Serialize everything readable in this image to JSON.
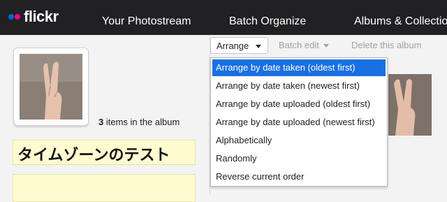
{
  "brand": {
    "name": "flickr",
    "dot_left_color": "#0063dc",
    "dot_right_color": "#ff0084"
  },
  "nav": {
    "items": [
      {
        "label": "Your Photostream"
      },
      {
        "label": "Batch Organize"
      },
      {
        "label": "Albums & Collectio"
      }
    ]
  },
  "album": {
    "count": "3",
    "count_suffix": " items in the album",
    "title": "タイムゾーンのテスト",
    "description": ""
  },
  "toolbar": {
    "arrange_label": "Arrange",
    "batch_edit_label": "Batch edit",
    "delete_label": "Delete this album"
  },
  "arrange_menu": {
    "items": [
      {
        "label": "Arrange by date taken (oldest first)",
        "selected": true
      },
      {
        "label": "Arrange by date taken (newest first)"
      },
      {
        "label": "Arrange by date uploaded (oldest first)"
      },
      {
        "label": "Arrange by date uploaded (newest first)"
      },
      {
        "label": "Alphabetically"
      },
      {
        "label": "Randomly"
      },
      {
        "label": "Reverse current order"
      }
    ]
  },
  "colors": {
    "topbar": "#212124",
    "selected_item": "#1a6fe1",
    "title_bg": "#fdfbcf"
  }
}
